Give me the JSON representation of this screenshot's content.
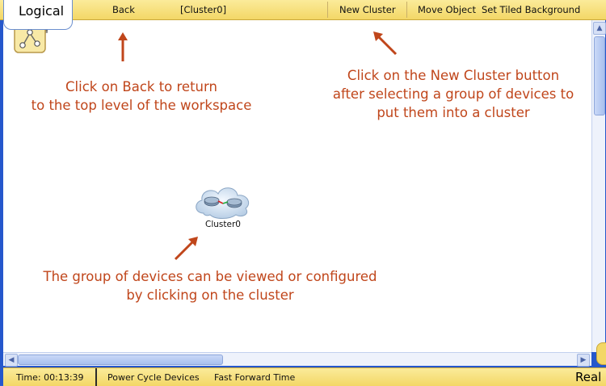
{
  "toolbar": {
    "logical_tab": "Logical",
    "back": "Back",
    "current_cluster": "[Cluster0]",
    "new_cluster": "New Cluster",
    "move_object": "Move Object",
    "set_tiled_background": "Set Tiled Background"
  },
  "annotations": {
    "back_line1": "Click on Back to return",
    "back_line2": "to the top level of the workspace",
    "new_cluster_line1": "Click on the New Cluster button",
    "new_cluster_line2": "after selecting a group of devices to",
    "new_cluster_line3": "put them into a cluster",
    "cluster_line1": "The group of devices can be viewed or configured",
    "cluster_line2": "by clicking on the cluster"
  },
  "canvas": {
    "cluster_label": "Cluster0"
  },
  "status": {
    "time": "Time: 00:13:39",
    "power_cycle": "Power Cycle Devices",
    "fast_forward": "Fast Forward Time",
    "realtime": "Real"
  },
  "colors": {
    "annotation": "#c0461b",
    "toolbar": "#f3d766",
    "frame": "#2557cc"
  },
  "icons": {
    "level": "level-up-icon",
    "cluster": "cluster-cloud-icon"
  }
}
